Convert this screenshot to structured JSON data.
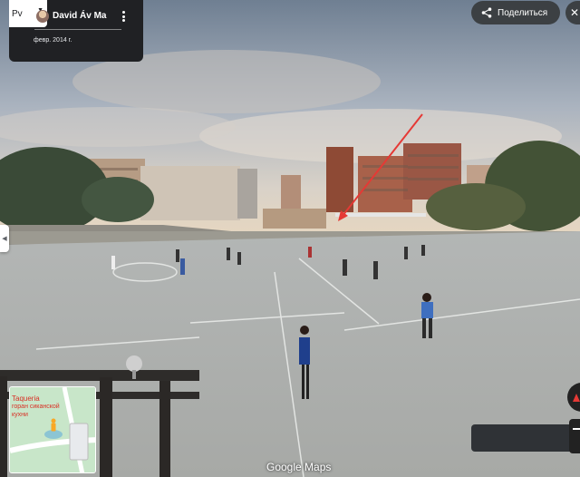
{
  "panel": {
    "thumb_label": "Pv",
    "author": "David Áv Ma",
    "date": "февр. 2014 г."
  },
  "actions": {
    "share_label": "Поделиться"
  },
  "minimap": {
    "poi_name": "Taqueria",
    "poi_sub": "горан сиканской кухни"
  },
  "watermark": "Google Maps",
  "colors": {
    "panel_bg": "#202124",
    "accent_red": "#e53935",
    "poi_red": "#d93025"
  },
  "icons": {
    "share": "share-icon",
    "more": "more-vert-icon",
    "pegman": "pegman-icon",
    "compass": "compass-icon"
  }
}
